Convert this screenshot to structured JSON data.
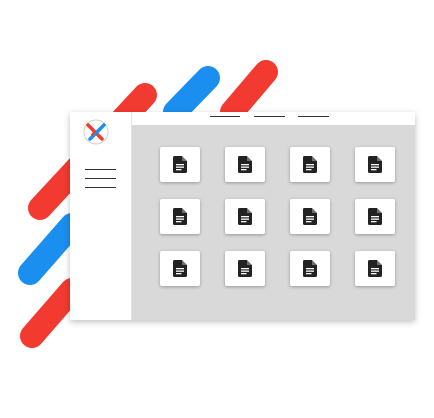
{
  "app": {
    "logo_name": "app-logo",
    "accent_red": "#f23a30",
    "accent_blue": "#1a8ff0"
  },
  "sidebar": {
    "menu_icon": "hamburger-menu-icon"
  },
  "topbar": {
    "tabs": [
      {
        "name": "tab-1"
      },
      {
        "name": "tab-2"
      },
      {
        "name": "tab-3"
      }
    ]
  },
  "grid": {
    "rows": 3,
    "columns": 4,
    "tile_icon": "document-icon",
    "tile_count": 12
  }
}
